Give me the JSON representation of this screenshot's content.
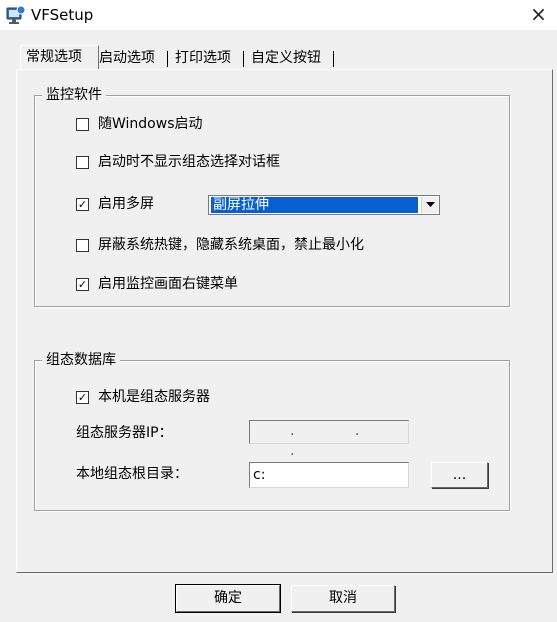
{
  "window": {
    "title": "VFSetup",
    "icon": "app-monitor-icon",
    "close_glyph": "×"
  },
  "tabs": [
    {
      "label": "常规选项",
      "active": true
    },
    {
      "label": "启动选项",
      "active": false
    },
    {
      "label": "打印选项",
      "active": false
    },
    {
      "label": "自定义按钮",
      "active": false
    }
  ],
  "monitor_group": {
    "title": "监控软件",
    "start_with_windows": {
      "label": "随Windows启动",
      "checked": false
    },
    "hide_config_dialog": {
      "label": "启动时不显示组态选择对话框",
      "checked": false
    },
    "multi_screen": {
      "label": "启用多屏",
      "checked": true
    },
    "multi_screen_mode": {
      "value": "副屏拉伸"
    },
    "shield_hotkeys": {
      "label": "屏蔽系统热键，隐藏系统桌面，禁止最小化",
      "checked": false
    },
    "context_menu": {
      "label": "启用监控画面右键菜单",
      "checked": true
    }
  },
  "db_group": {
    "title": "组态数据库",
    "is_server": {
      "label": "本机是组态服务器",
      "checked": true
    },
    "server_ip": {
      "label": "组态服务器IP：",
      "value": ". . ."
    },
    "root_dir": {
      "label": "本地组态根目录：",
      "value": "c:"
    },
    "browse_label": "..."
  },
  "buttons": {
    "ok": "确定",
    "cancel": "取消"
  },
  "checkmark_glyph": "✓"
}
